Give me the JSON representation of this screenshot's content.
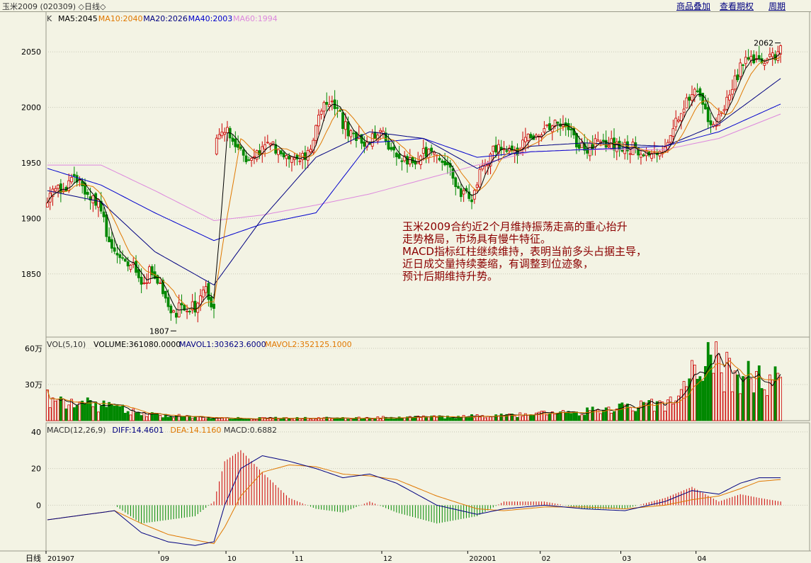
{
  "header": {
    "title": "玉米2009 (020309) ◇日线◇",
    "links": [
      "商品叠加",
      "查看期权",
      "周期"
    ]
  },
  "colors": {
    "up": "#cc0000",
    "down": "#008800",
    "ma5": "#000000",
    "ma10": "#e07800",
    "ma20": "#000080",
    "ma40": "#0000cc",
    "ma60": "#dd88dd",
    "diff": "#000080",
    "dea": "#e07800"
  },
  "chart_data": [
    {
      "type": "candlestick",
      "title": "K",
      "legend": [
        {
          "name": "MA5",
          "value": "2045"
        },
        {
          "name": "MA10",
          "value": "2040"
        },
        {
          "name": "MA20",
          "value": "2026"
        },
        {
          "name": "MA40",
          "value": "2003"
        },
        {
          "name": "MA60",
          "value": "1994"
        }
      ],
      "y_ticks": [
        1850,
        1900,
        1950,
        2000,
        2050
      ],
      "ylim": [
        1795,
        2075
      ],
      "high_marker": "2062",
      "low_marker": "1807",
      "close_points": [
        [
          0,
          1918
        ],
        [
          5,
          1928
        ],
        [
          10,
          1933
        ],
        [
          15,
          1925
        ],
        [
          19,
          1912
        ],
        [
          23,
          1880
        ],
        [
          27,
          1860
        ],
        [
          31,
          1860
        ],
        [
          35,
          1840
        ],
        [
          39,
          1855
        ],
        [
          43,
          1830
        ],
        [
          47,
          1815
        ],
        [
          51,
          1822
        ],
        [
          55,
          1818
        ],
        [
          59,
          1835
        ],
        [
          62,
          1815
        ],
        [
          63,
          1970
        ],
        [
          66,
          1982
        ],
        [
          70,
          1962
        ],
        [
          74,
          1955
        ],
        [
          78,
          1960
        ],
        [
          82,
          1965
        ],
        [
          86,
          1962
        ],
        [
          90,
          1958
        ],
        [
          94,
          1957
        ],
        [
          98,
          1958
        ],
        [
          102,
          1998
        ],
        [
          106,
          2010
        ],
        [
          110,
          1985
        ],
        [
          114,
          1972
        ],
        [
          118,
          1968
        ],
        [
          122,
          1975
        ],
        [
          126,
          1972
        ],
        [
          130,
          1955
        ],
        [
          134,
          1950
        ],
        [
          138,
          1955
        ],
        [
          142,
          1962
        ],
        [
          146,
          1955
        ],
        [
          150,
          1942
        ],
        [
          154,
          1925
        ],
        [
          158,
          1918
        ],
        [
          162,
          1945
        ],
        [
          166,
          1962
        ],
        [
          170,
          1960
        ],
        [
          174,
          1958
        ],
        [
          178,
          1975
        ],
        [
          182,
          1975
        ],
        [
          186,
          1982
        ],
        [
          190,
          1990
        ],
        [
          194,
          1978
        ],
        [
          198,
          1962
        ],
        [
          202,
          1965
        ],
        [
          206,
          1970
        ],
        [
          210,
          1968
        ],
        [
          214,
          1962
        ],
        [
          218,
          1965
        ],
        [
          222,
          1955
        ],
        [
          226,
          1962
        ],
        [
          230,
          1965
        ],
        [
          234,
          1985
        ],
        [
          238,
          2010
        ],
        [
          242,
          2018
        ],
        [
          246,
          1990
        ],
        [
          250,
          1988
        ],
        [
          254,
          2010
        ],
        [
          258,
          2035
        ],
        [
          262,
          2045
        ],
        [
          266,
          2040
        ],
        [
          270,
          2045
        ],
        [
          273,
          2052
        ]
      ],
      "ma_points": {
        "MA20": [
          [
            0,
            1925
          ],
          [
            20,
            1915
          ],
          [
            40,
            1870
          ],
          [
            62,
            1840
          ],
          [
            80,
            1900
          ],
          [
            100,
            1955
          ],
          [
            120,
            1978
          ],
          [
            140,
            1972
          ],
          [
            160,
            1945
          ],
          [
            180,
            1965
          ],
          [
            200,
            1968
          ],
          [
            230,
            1965
          ],
          [
            250,
            1985
          ],
          [
            273,
            2026
          ]
        ],
        "MA40": [
          [
            0,
            1945
          ],
          [
            20,
            1930
          ],
          [
            40,
            1905
          ],
          [
            62,
            1880
          ],
          [
            80,
            1895
          ],
          [
            100,
            1905
          ],
          [
            120,
            1968
          ],
          [
            140,
            1972
          ],
          [
            160,
            1955
          ],
          [
            180,
            1960
          ],
          [
            200,
            1962
          ],
          [
            230,
            1965
          ],
          [
            250,
            1978
          ],
          [
            273,
            2003
          ]
        ],
        "MA60": [
          [
            0,
            1948
          ],
          [
            20,
            1948
          ],
          [
            40,
            1925
          ],
          [
            62,
            1898
          ],
          [
            80,
            1903
          ],
          [
            100,
            1912
          ],
          [
            120,
            1922
          ],
          [
            140,
            1935
          ],
          [
            160,
            1948
          ],
          [
            180,
            1960
          ],
          [
            200,
            1962
          ],
          [
            230,
            1962
          ],
          [
            250,
            1972
          ],
          [
            273,
            1994
          ]
        ]
      },
      "annotation": [
        "玉米2009合约近2个月维持振荡走高的重心抬升",
        "走势格局，市场具有慢牛特征。",
        "MACD指标红柱继续维持，表明当前多头占据主导，",
        "近日成交量持续萎缩，有调整到位迹象，",
        "预计后期维持升势。"
      ]
    },
    {
      "type": "bar",
      "title": "VOL(5,10)",
      "legend": [
        {
          "name": "VOLUME",
          "value": "361080.0000"
        },
        {
          "name": "MAVOL1",
          "value": "303623.6000"
        },
        {
          "name": "MAVOL2",
          "value": "352125.1000"
        }
      ],
      "y_ticks": [
        "30万",
        "60万"
      ],
      "volume_points": [
        [
          0,
          18
        ],
        [
          10,
          15
        ],
        [
          25,
          10
        ],
        [
          40,
          5
        ],
        [
          60,
          2
        ],
        [
          100,
          2
        ],
        [
          150,
          3
        ],
        [
          190,
          6
        ],
        [
          210,
          9
        ],
        [
          220,
          12
        ],
        [
          232,
          14
        ],
        [
          238,
          25
        ],
        [
          240,
          35
        ],
        [
          244,
          55
        ],
        [
          250,
          45
        ],
        [
          256,
          40
        ],
        [
          262,
          35
        ],
        [
          268,
          28
        ],
        [
          273,
          33
        ]
      ]
    },
    {
      "type": "bar",
      "title": "MACD(12,26,9)",
      "legend": [
        {
          "name": "DIFF",
          "value": "14.4601"
        },
        {
          "name": "DEA",
          "value": "14.1160"
        },
        {
          "name": "MACD",
          "value": "0.6882"
        }
      ],
      "y_ticks": [
        0,
        20,
        40
      ],
      "ylim": [
        -25,
        45
      ],
      "diff_points": [
        [
          0,
          -8
        ],
        [
          15,
          -5
        ],
        [
          25,
          -3
        ],
        [
          35,
          -15
        ],
        [
          45,
          -20
        ],
        [
          55,
          -22
        ],
        [
          62,
          -20
        ],
        [
          66,
          0
        ],
        [
          72,
          20
        ],
        [
          80,
          27
        ],
        [
          90,
          24
        ],
        [
          100,
          20
        ],
        [
          110,
          15
        ],
        [
          120,
          17
        ],
        [
          130,
          12
        ],
        [
          145,
          0
        ],
        [
          160,
          -5
        ],
        [
          170,
          -2
        ],
        [
          185,
          0
        ],
        [
          200,
          -2
        ],
        [
          215,
          -3
        ],
        [
          230,
          2
        ],
        [
          240,
          8
        ],
        [
          250,
          6
        ],
        [
          258,
          12
        ],
        [
          265,
          15
        ],
        [
          273,
          15
        ]
      ],
      "dea_points": [
        [
          0,
          -8
        ],
        [
          15,
          -5
        ],
        [
          25,
          -3
        ],
        [
          35,
          -10
        ],
        [
          45,
          -16
        ],
        [
          55,
          -19
        ],
        [
          62,
          -21
        ],
        [
          66,
          -12
        ],
        [
          72,
          5
        ],
        [
          80,
          18
        ],
        [
          90,
          22
        ],
        [
          100,
          21
        ],
        [
          110,
          17
        ],
        [
          120,
          16
        ],
        [
          130,
          14
        ],
        [
          145,
          5
        ],
        [
          160,
          -2
        ],
        [
          170,
          -3
        ],
        [
          185,
          -1
        ],
        [
          200,
          -1
        ],
        [
          215,
          -2
        ],
        [
          230,
          0
        ],
        [
          240,
          3
        ],
        [
          250,
          5
        ],
        [
          258,
          9
        ],
        [
          265,
          13
        ],
        [
          273,
          14
        ]
      ]
    }
  ],
  "x_axis": {
    "corner_label": "日线",
    "labels": [
      {
        "i": 0,
        "text": "201907"
      },
      {
        "i": 42,
        "text": "09"
      },
      {
        "i": 67,
        "text": "10"
      },
      {
        "i": 92,
        "text": "11"
      },
      {
        "i": 125,
        "text": "12"
      },
      {
        "i": 157,
        "text": "202001"
      },
      {
        "i": 184,
        "text": "02"
      },
      {
        "i": 214,
        "text": "03"
      },
      {
        "i": 242,
        "text": "04"
      }
    ]
  }
}
